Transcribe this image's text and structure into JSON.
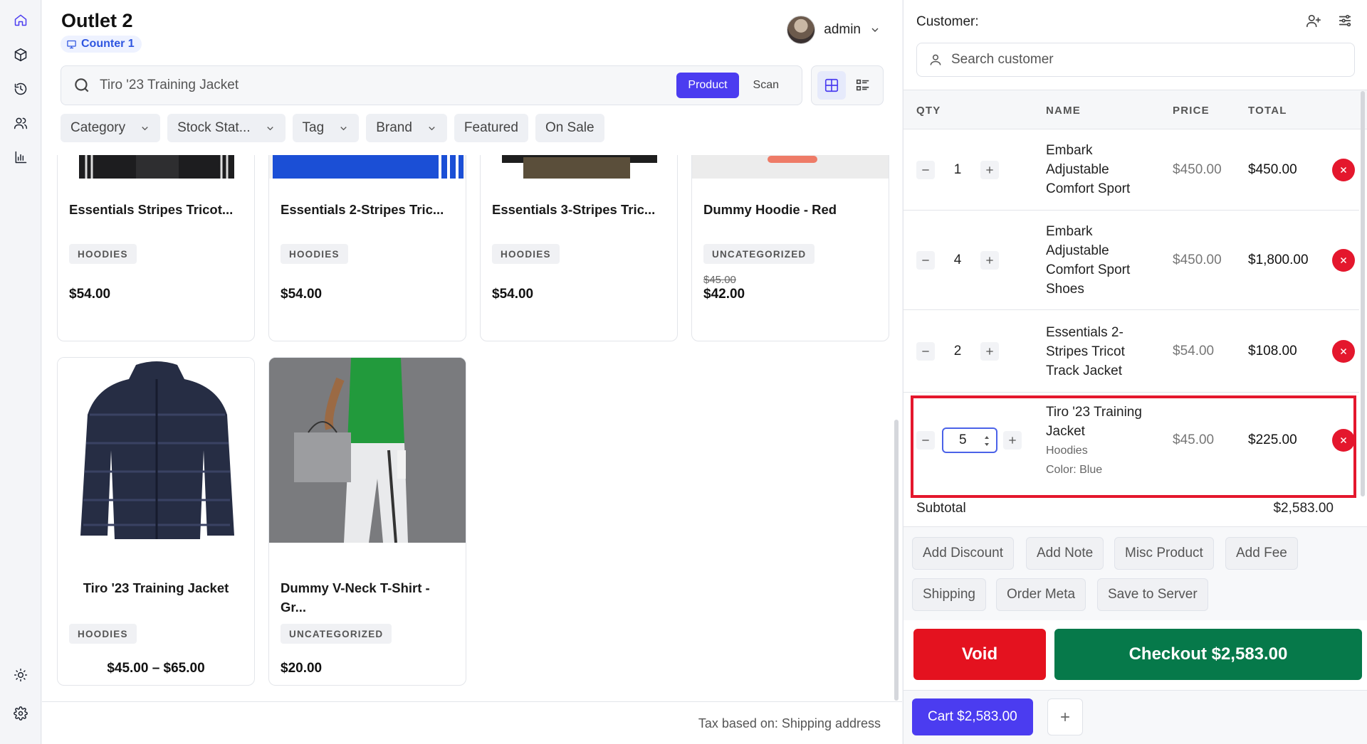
{
  "header": {
    "outlet_title": "Outlet 2",
    "counter_label": "Counter 1",
    "user_name": "admin"
  },
  "search": {
    "placeholder": "Tiro '23 Training Jacket",
    "mode_product": "Product",
    "mode_scan": "Scan"
  },
  "filters": [
    "Category",
    "Stock Stat...",
    "Tag",
    "Brand",
    "Featured",
    "On Sale"
  ],
  "products": [
    {
      "name": "Essentials Stripes Tricot...",
      "tag": "HOODIES",
      "price": "$54.00"
    },
    {
      "name": "Essentials 2-Stripes Tric...",
      "tag": "HOODIES",
      "price": "$54.00"
    },
    {
      "name": "Essentials 3-Stripes Tric...",
      "tag": "HOODIES",
      "price": "$54.00"
    },
    {
      "name": "Dummy Hoodie - Red",
      "tag": "UNCATEGORIZED",
      "old_price": "$45.00",
      "price": "$42.00"
    },
    {
      "name": "Tiro '23 Training Jacket",
      "tag": "HOODIES",
      "price": "$45.00 – $65.00"
    },
    {
      "name": "Dummy V-Neck T-Shirt - Gr...",
      "tag": "UNCATEGORIZED",
      "price": "$20.00"
    }
  ],
  "footer": {
    "tax_text": "Tax based on: Shipping address"
  },
  "customer": {
    "label": "Customer:",
    "search_placeholder": "Search customer"
  },
  "cart": {
    "columns": [
      "QTY",
      "NAME",
      "PRICE",
      "TOTAL"
    ],
    "items": [
      {
        "qty": "1",
        "name": "Embark Adjustable Comfort Sport",
        "price": "$450.00",
        "total": "$450.00"
      },
      {
        "qty": "4",
        "name": "Embark Adjustable Comfort Sport Shoes",
        "price": "$450.00",
        "total": "$1,800.00"
      },
      {
        "qty": "2",
        "name": "Essentials 2-Stripes Tricot Track Jacket",
        "price": "$54.00",
        "total": "$108.00"
      },
      {
        "qty": "5",
        "name": "Tiro '23 Training Jacket",
        "category": "Hoodies",
        "attr": "Color: Blue",
        "price": "$45.00",
        "total": "$225.00"
      }
    ],
    "subtotal_label": "Subtotal",
    "subtotal_value": "$2,583.00",
    "actions": [
      "Add Discount",
      "Add Note",
      "Misc Product",
      "Add Fee",
      "Shipping",
      "Order Meta",
      "Save to Server"
    ],
    "void_label": "Void",
    "checkout_label": "Checkout $2,583.00",
    "cart_tab_label": "Cart $2,583.00"
  },
  "colors": {
    "accent": "#4b3cf0",
    "void": "#e4121f",
    "checkout": "#06794a",
    "remove": "#e4172d"
  }
}
